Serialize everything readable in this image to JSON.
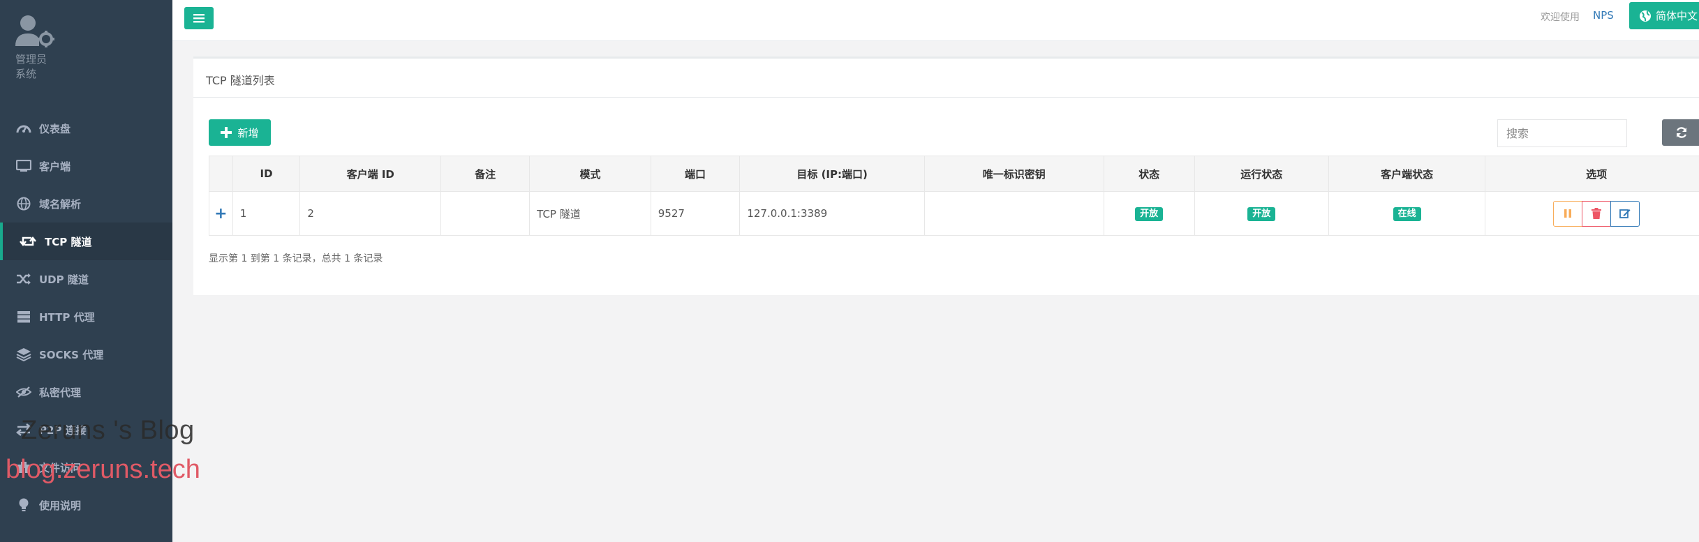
{
  "sidebar": {
    "role_line1": "管理员",
    "role_line2": "系统",
    "items": [
      {
        "label": "仪表盘",
        "icon": "dashboard-icon"
      },
      {
        "label": "客户端",
        "icon": "monitor-icon"
      },
      {
        "label": "域名解析",
        "icon": "globe-icon"
      },
      {
        "label": "TCP 隧道",
        "icon": "retweet-icon",
        "active": true
      },
      {
        "label": "UDP 隧道",
        "icon": "random-icon"
      },
      {
        "label": "HTTP 代理",
        "icon": "server-icon"
      },
      {
        "label": "SOCKS 代理",
        "icon": "layers-icon"
      },
      {
        "label": "私密代理",
        "icon": "eye-slash-icon"
      },
      {
        "label": "P2P 连接",
        "icon": "exchange-icon"
      },
      {
        "label": "文件访问",
        "icon": "hospital-icon"
      },
      {
        "label": "使用说明",
        "icon": "lightbulb-icon"
      }
    ]
  },
  "watermark": {
    "line1": "Zeruns 's Blog",
    "line2": "blog.zeruns.tech"
  },
  "topbar": {
    "welcome": "欢迎使用",
    "brand": "NPS",
    "language": "简体中文"
  },
  "panel": {
    "title": "TCP 隧道列表",
    "add_label": "新增",
    "search_placeholder": "搜索",
    "columns": [
      "",
      "ID",
      "客户端 ID",
      "备注",
      "模式",
      "端口",
      "目标 (IP:端口)",
      "唯一标识密钥",
      "状态",
      "运行状态",
      "客户端状态",
      "选项"
    ],
    "rows": [
      {
        "expand": "+",
        "id": "1",
        "client_id": "2",
        "remark": "",
        "mode": "TCP 隧道",
        "port": "9527",
        "target": "127.0.0.1:3389",
        "key": "",
        "status": "开放",
        "run_status": "开放",
        "client_status": "在线"
      }
    ],
    "footer": "显示第 1 到第 1 条记录，总共 1 条记录"
  },
  "colors": {
    "sidebar_bg": "#2f4050",
    "accent": "#1ab394",
    "link": "#337ab7",
    "warning": "#f8ac59",
    "danger": "#ed5565"
  }
}
